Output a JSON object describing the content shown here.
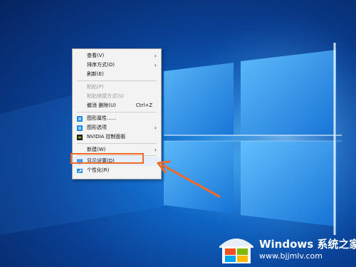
{
  "context_menu": {
    "items": [
      {
        "label": "查看(V)",
        "submenu": true
      },
      {
        "label": "排序方式(O)",
        "submenu": true
      },
      {
        "label": "刷新(E)"
      },
      {
        "label": "粘贴(P)",
        "disabled": true
      },
      {
        "label": "粘贴快捷方式(S)",
        "disabled": true
      },
      {
        "label": "撤消 删除(U)",
        "shortcut": "Ctrl+Z"
      },
      {
        "label": "图形属性......",
        "icon": "intel-graphics-icon"
      },
      {
        "label": "图形选项",
        "icon": "intel-graphics-icon",
        "submenu": true
      },
      {
        "label": "NVIDIA 控制面板",
        "icon": "nvidia-icon"
      },
      {
        "label": "新建(W)",
        "submenu": true
      },
      {
        "label": "显示设置(D)",
        "icon": "display-settings-icon",
        "highlighted": true
      },
      {
        "label": "个性化(R)",
        "icon": "personalize-icon"
      }
    ]
  },
  "watermark": {
    "title": "Windows 系统之家",
    "url": "www.bjjmlv.com"
  },
  "colors": {
    "callout": "#f06a2a",
    "desktop_blue": "#0e63c2"
  }
}
